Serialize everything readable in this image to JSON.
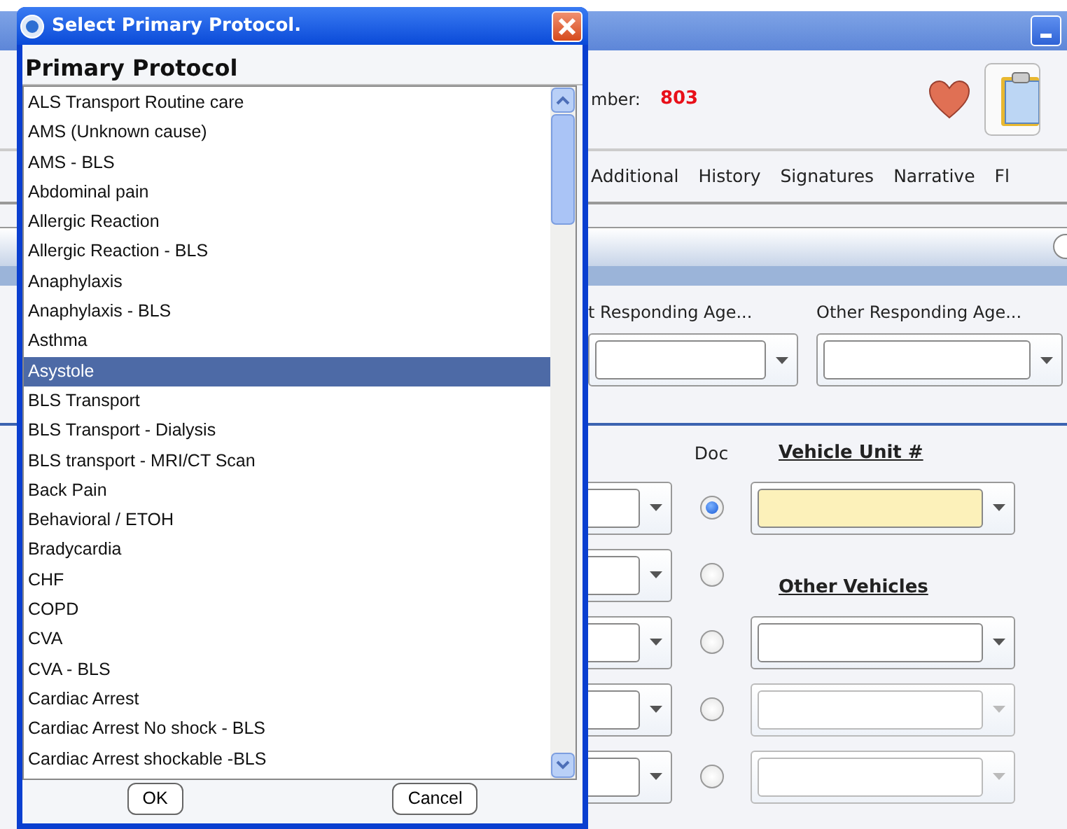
{
  "window": {
    "number_label": "mber:",
    "number": "803",
    "tabs": [
      {
        "label": "Additional"
      },
      {
        "label": "History"
      },
      {
        "label": "Signatures"
      },
      {
        "label": "Narrative"
      },
      {
        "label": "Fl"
      }
    ],
    "agencies": [
      {
        "label": "t Responding Age..."
      },
      {
        "label": "Other Responding Age..."
      }
    ],
    "doc_label": "Doc",
    "vehicle_unit_label": "Vehicle Unit #",
    "vehicle_unit_required": true,
    "other_vehicles_label": "Other Vehicles",
    "crew_rows": [
      {
        "selected": true
      },
      {
        "selected": false
      },
      {
        "selected": false
      },
      {
        "selected": false
      },
      {
        "selected": false
      }
    ],
    "other_vehicles": [
      {
        "disabled": false
      },
      {
        "disabled": true
      },
      {
        "disabled": true
      }
    ]
  },
  "dialog": {
    "title": "Select Primary Protocol.",
    "heading": "Primary Protocol",
    "items": [
      {
        "label": "ALS Transport Routine care",
        "selected": false
      },
      {
        "label": "AMS (Unknown cause)",
        "selected": false
      },
      {
        "label": "AMS - BLS",
        "selected": false
      },
      {
        "label": "Abdominal pain",
        "selected": false
      },
      {
        "label": "Allergic Reaction",
        "selected": false
      },
      {
        "label": "Allergic Reaction - BLS",
        "selected": false
      },
      {
        "label": "Anaphylaxis",
        "selected": false
      },
      {
        "label": "Anaphylaxis - BLS",
        "selected": false
      },
      {
        "label": "Asthma",
        "selected": false
      },
      {
        "label": "Asystole",
        "selected": true
      },
      {
        "label": "BLS Transport",
        "selected": false
      },
      {
        "label": "BLS Transport - Dialysis",
        "selected": false
      },
      {
        "label": "BLS transport - MRI/CT Scan",
        "selected": false
      },
      {
        "label": "Back Pain",
        "selected": false
      },
      {
        "label": "Behavioral / ETOH",
        "selected": false
      },
      {
        "label": "Bradycardia",
        "selected": false
      },
      {
        "label": "CHF",
        "selected": false
      },
      {
        "label": "COPD",
        "selected": false
      },
      {
        "label": "CVA",
        "selected": false
      },
      {
        "label": "CVA - BLS",
        "selected": false
      },
      {
        "label": "Cardiac Arrest",
        "selected": false
      },
      {
        "label": "Cardiac Arrest No shock - BLS",
        "selected": false
      },
      {
        "label": "Cardiac Arrest shockable -BLS",
        "selected": false
      }
    ],
    "buttons": [
      "OK",
      "Cancel"
    ]
  }
}
